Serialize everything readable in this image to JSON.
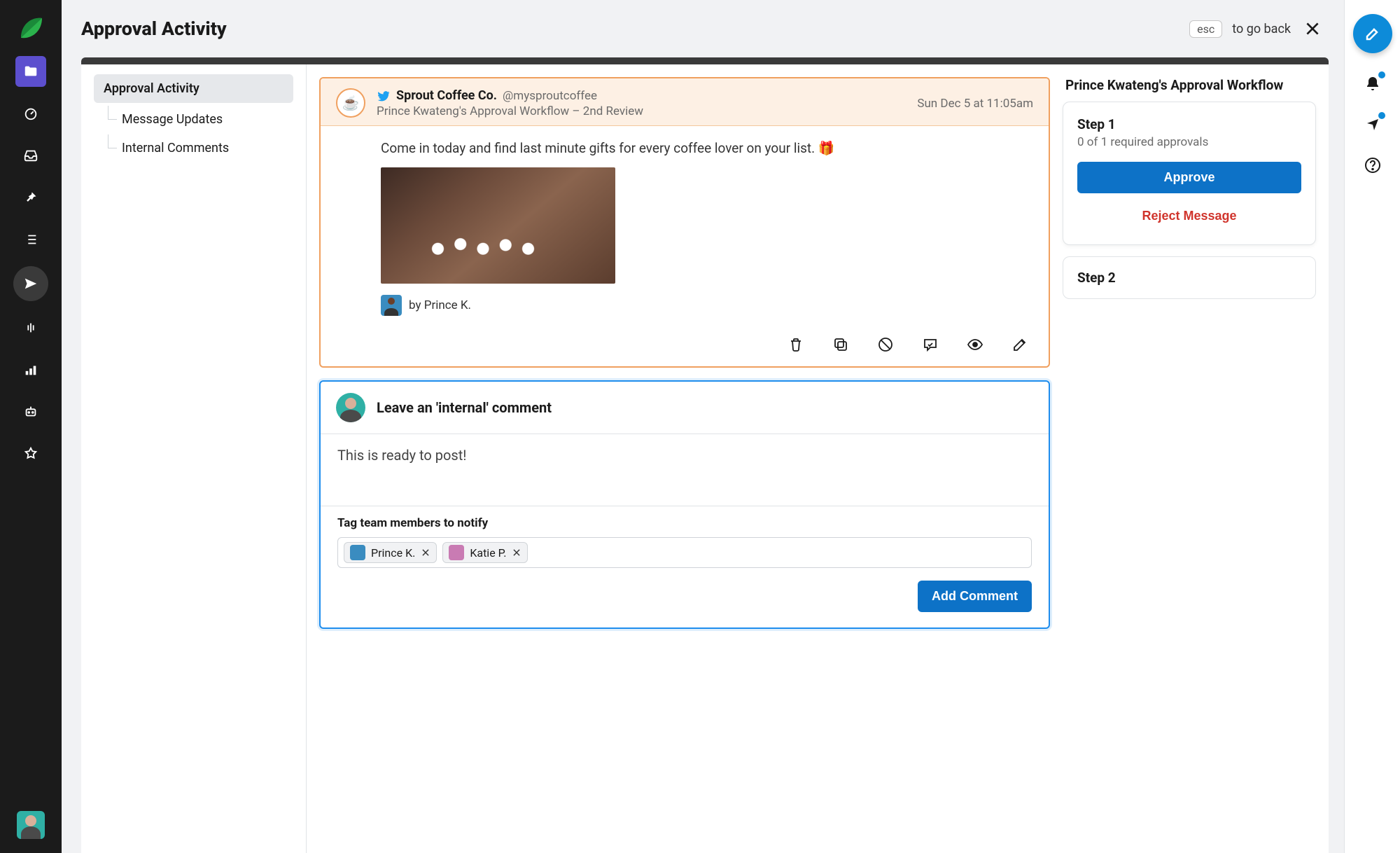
{
  "header": {
    "title": "Approval Activity",
    "esc_label": "esc",
    "go_back_label": "to go back"
  },
  "side_tabs": {
    "main": "Approval Activity",
    "message_updates": "Message Updates",
    "internal_comments": "Internal Comments"
  },
  "message": {
    "profile_emoji": "☕",
    "account_name": "Sprout Coffee Co.",
    "account_handle": "@mysproutcoffee",
    "workflow_line": "Prince Kwateng's Approval Workflow – 2nd Review",
    "timestamp": "Sun Dec 5 at 11:05am",
    "text": "Come in today and find last minute gifts for every coffee lover on your list. 🎁",
    "author_label": "by Prince K."
  },
  "message_actions": {
    "delete": "Delete",
    "copy": "Copy",
    "block": "Block",
    "comment": "Comment",
    "preview": "Preview",
    "edit": "Edit"
  },
  "comment_box": {
    "title": "Leave an 'internal' comment",
    "draft_text": "This is ready to post!",
    "tag_label": "Tag team members to notify",
    "tags": [
      {
        "name": "Prince K."
      },
      {
        "name": "Katie P."
      }
    ],
    "submit_label": "Add Comment"
  },
  "workflow": {
    "title": "Prince Kwateng's Approval Workflow",
    "step1": {
      "title": "Step 1",
      "sub": "0 of 1 required approvals",
      "approve": "Approve",
      "reject": "Reject Message"
    },
    "step2": {
      "title": "Step 2"
    }
  }
}
